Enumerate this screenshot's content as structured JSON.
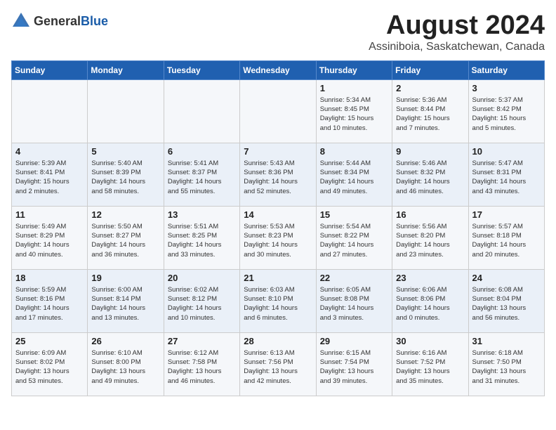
{
  "header": {
    "logo_general": "General",
    "logo_blue": "Blue",
    "month_title": "August 2024",
    "location": "Assiniboia, Saskatchewan, Canada"
  },
  "calendar": {
    "days_of_week": [
      "Sunday",
      "Monday",
      "Tuesday",
      "Wednesday",
      "Thursday",
      "Friday",
      "Saturday"
    ],
    "weeks": [
      [
        {
          "day": "",
          "info": ""
        },
        {
          "day": "",
          "info": ""
        },
        {
          "day": "",
          "info": ""
        },
        {
          "day": "",
          "info": ""
        },
        {
          "day": "1",
          "info": "Sunrise: 5:34 AM\nSunset: 8:45 PM\nDaylight: 15 hours\nand 10 minutes."
        },
        {
          "day": "2",
          "info": "Sunrise: 5:36 AM\nSunset: 8:44 PM\nDaylight: 15 hours\nand 7 minutes."
        },
        {
          "day": "3",
          "info": "Sunrise: 5:37 AM\nSunset: 8:42 PM\nDaylight: 15 hours\nand 5 minutes."
        }
      ],
      [
        {
          "day": "4",
          "info": "Sunrise: 5:39 AM\nSunset: 8:41 PM\nDaylight: 15 hours\nand 2 minutes."
        },
        {
          "day": "5",
          "info": "Sunrise: 5:40 AM\nSunset: 8:39 PM\nDaylight: 14 hours\nand 58 minutes."
        },
        {
          "day": "6",
          "info": "Sunrise: 5:41 AM\nSunset: 8:37 PM\nDaylight: 14 hours\nand 55 minutes."
        },
        {
          "day": "7",
          "info": "Sunrise: 5:43 AM\nSunset: 8:36 PM\nDaylight: 14 hours\nand 52 minutes."
        },
        {
          "day": "8",
          "info": "Sunrise: 5:44 AM\nSunset: 8:34 PM\nDaylight: 14 hours\nand 49 minutes."
        },
        {
          "day": "9",
          "info": "Sunrise: 5:46 AM\nSunset: 8:32 PM\nDaylight: 14 hours\nand 46 minutes."
        },
        {
          "day": "10",
          "info": "Sunrise: 5:47 AM\nSunset: 8:31 PM\nDaylight: 14 hours\nand 43 minutes."
        }
      ],
      [
        {
          "day": "11",
          "info": "Sunrise: 5:49 AM\nSunset: 8:29 PM\nDaylight: 14 hours\nand 40 minutes."
        },
        {
          "day": "12",
          "info": "Sunrise: 5:50 AM\nSunset: 8:27 PM\nDaylight: 14 hours\nand 36 minutes."
        },
        {
          "day": "13",
          "info": "Sunrise: 5:51 AM\nSunset: 8:25 PM\nDaylight: 14 hours\nand 33 minutes."
        },
        {
          "day": "14",
          "info": "Sunrise: 5:53 AM\nSunset: 8:23 PM\nDaylight: 14 hours\nand 30 minutes."
        },
        {
          "day": "15",
          "info": "Sunrise: 5:54 AM\nSunset: 8:22 PM\nDaylight: 14 hours\nand 27 minutes."
        },
        {
          "day": "16",
          "info": "Sunrise: 5:56 AM\nSunset: 8:20 PM\nDaylight: 14 hours\nand 23 minutes."
        },
        {
          "day": "17",
          "info": "Sunrise: 5:57 AM\nSunset: 8:18 PM\nDaylight: 14 hours\nand 20 minutes."
        }
      ],
      [
        {
          "day": "18",
          "info": "Sunrise: 5:59 AM\nSunset: 8:16 PM\nDaylight: 14 hours\nand 17 minutes."
        },
        {
          "day": "19",
          "info": "Sunrise: 6:00 AM\nSunset: 8:14 PM\nDaylight: 14 hours\nand 13 minutes."
        },
        {
          "day": "20",
          "info": "Sunrise: 6:02 AM\nSunset: 8:12 PM\nDaylight: 14 hours\nand 10 minutes."
        },
        {
          "day": "21",
          "info": "Sunrise: 6:03 AM\nSunset: 8:10 PM\nDaylight: 14 hours\nand 6 minutes."
        },
        {
          "day": "22",
          "info": "Sunrise: 6:05 AM\nSunset: 8:08 PM\nDaylight: 14 hours\nand 3 minutes."
        },
        {
          "day": "23",
          "info": "Sunrise: 6:06 AM\nSunset: 8:06 PM\nDaylight: 14 hours\nand 0 minutes."
        },
        {
          "day": "24",
          "info": "Sunrise: 6:08 AM\nSunset: 8:04 PM\nDaylight: 13 hours\nand 56 minutes."
        }
      ],
      [
        {
          "day": "25",
          "info": "Sunrise: 6:09 AM\nSunset: 8:02 PM\nDaylight: 13 hours\nand 53 minutes."
        },
        {
          "day": "26",
          "info": "Sunrise: 6:10 AM\nSunset: 8:00 PM\nDaylight: 13 hours\nand 49 minutes."
        },
        {
          "day": "27",
          "info": "Sunrise: 6:12 AM\nSunset: 7:58 PM\nDaylight: 13 hours\nand 46 minutes."
        },
        {
          "day": "28",
          "info": "Sunrise: 6:13 AM\nSunset: 7:56 PM\nDaylight: 13 hours\nand 42 minutes."
        },
        {
          "day": "29",
          "info": "Sunrise: 6:15 AM\nSunset: 7:54 PM\nDaylight: 13 hours\nand 39 minutes."
        },
        {
          "day": "30",
          "info": "Sunrise: 6:16 AM\nSunset: 7:52 PM\nDaylight: 13 hours\nand 35 minutes."
        },
        {
          "day": "31",
          "info": "Sunrise: 6:18 AM\nSunset: 7:50 PM\nDaylight: 13 hours\nand 31 minutes."
        }
      ]
    ]
  }
}
